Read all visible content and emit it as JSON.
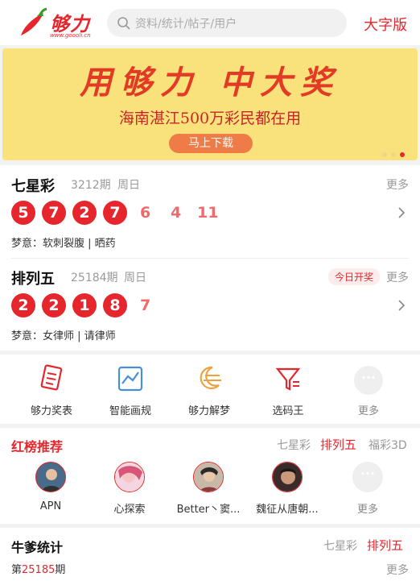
{
  "header": {
    "logo_text": "够力",
    "logo_sub": "www.goooli.cn",
    "search_placeholder": "资料/统计/帖子/用户",
    "bigfont_label": "大字版"
  },
  "banner": {
    "title": "用够力 中大奖",
    "subtitle": "海南湛江500万彩民都在用",
    "button": "马上下载",
    "dots": 3,
    "active_dot": 2
  },
  "lotteries": [
    {
      "name": "七星彩",
      "issue": "3212期",
      "day": "周日",
      "more": "更多",
      "red_balls": [
        "5",
        "7",
        "2",
        "7"
      ],
      "plain_nums": [
        "6",
        "4",
        "11"
      ],
      "dream": "梦意：软刺裂腹 | 晒药"
    },
    {
      "name": "排列五",
      "issue": "25184期",
      "day": "周日",
      "badge": "今日开奖",
      "more": "更多",
      "red_balls": [
        "2",
        "2",
        "1",
        "8"
      ],
      "plain_nums": [
        "7"
      ],
      "dream": "梦意：女律师 | 请律师"
    }
  ],
  "tools": [
    {
      "label": "够力奖表",
      "icon": "lottery-sheet-icon"
    },
    {
      "label": "智能画规",
      "icon": "chart-icon"
    },
    {
      "label": "够力解梦",
      "icon": "moon-dream-icon"
    },
    {
      "label": "选码王",
      "icon": "filter-icon"
    },
    {
      "label": "更多",
      "icon": "more-dots-icon"
    }
  ],
  "rank": {
    "title": "红榜推荐",
    "tabs": [
      "七星彩",
      "排列五",
      "福彩3D"
    ],
    "active_tab": 1,
    "users": [
      {
        "name": "APN"
      },
      {
        "name": "心探索"
      },
      {
        "name": "Better丶窦..."
      },
      {
        "name": "魏征从唐朝..."
      },
      {
        "name": "更多"
      }
    ]
  },
  "stats": {
    "title": "牛爹统计",
    "tabs": [
      "七星彩",
      "排列五"
    ],
    "active_tab": 1,
    "issue_prefix": "第",
    "issue_num": "25185",
    "issue_suffix": "期",
    "more": "更多"
  },
  "colors": {
    "brand_red": "#e5262c",
    "banner_bg": "#f9e27b",
    "banner_btn": "#ef7b46"
  }
}
